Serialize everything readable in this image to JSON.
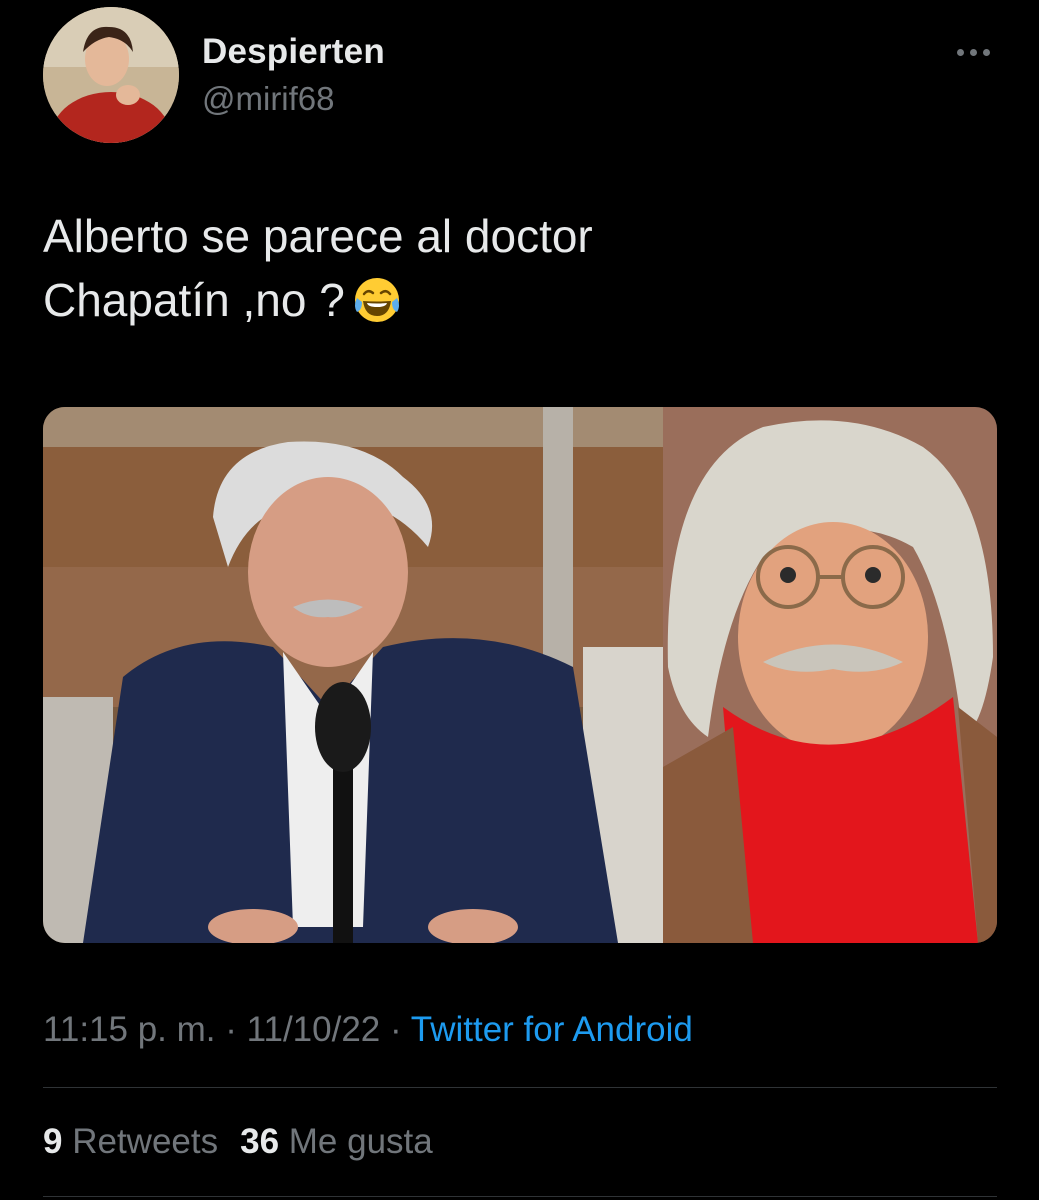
{
  "user": {
    "display_name": "Despierten",
    "handle": "@mirif68"
  },
  "tweet": {
    "text_line1": "Alberto se parece al doctor",
    "text_line2": "Chapatín ,no ?",
    "emoji": "face-with-tears-of-joy"
  },
  "meta": {
    "time": "11:15 p. m.",
    "sep1": " · ",
    "date": "11/10/22",
    "sep2": " · ",
    "source": "Twitter for Android"
  },
  "stats": {
    "retweets_count": "9",
    "retweets_label": "Retweets",
    "likes_count": "36",
    "likes_label": "Me gusta"
  },
  "colors": {
    "background": "#000000",
    "text": "#e7e9ea",
    "secondary": "#71767b",
    "link": "#1d9bf0",
    "divider": "#2f3336"
  }
}
